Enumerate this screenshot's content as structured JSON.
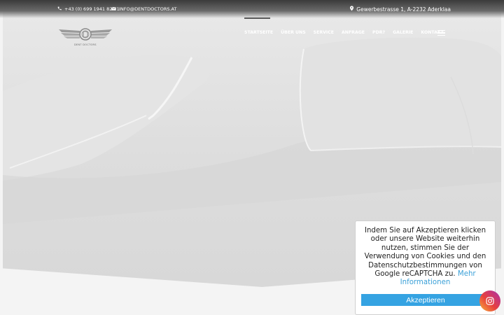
{
  "topbar": {
    "phone": "+43 (0) 699 1941 82 71",
    "email": "INFO@DENTDOCTORS.AT",
    "address": "Gewerbestrasse 1, A-2232 Aderklaa"
  },
  "logo": {
    "subtext": "DENT DOCTORS"
  },
  "nav": {
    "items": [
      "STARTSEITE",
      "ÜBER UNS",
      "SERVICE",
      "ANFRAGE",
      "PDR?",
      "GALERIE",
      "KONTAKT"
    ],
    "active": "STARTSEITE"
  },
  "cookie": {
    "message": "Indem Sie auf Akzeptieren klicken oder unsere Website weiterhin nutzen, stimmen Sie der Verwendung von Cookies und den Datenschutzbestimmungen von Google reCAPTCHA zu.",
    "more_link": "Mehr Informationen",
    "accept_label": "Akzeptieren"
  },
  "colors": {
    "accent": "#35a3e2",
    "link": "#3aa0d8"
  },
  "icons": {
    "phone": "phone-icon",
    "email": "envelope-icon",
    "address": "map-pin-icon",
    "menu": "hamburger-menu-icon",
    "social": "instagram-icon"
  }
}
